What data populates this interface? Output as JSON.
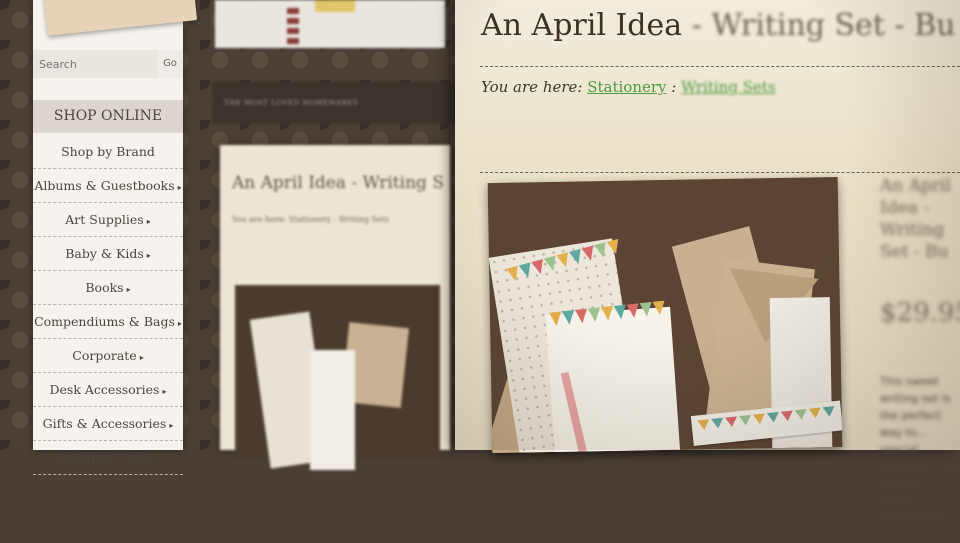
{
  "sidebar": {
    "search_placeholder": "Search",
    "go_label": "Go",
    "shop_title": "SHOP ONLINE",
    "items": [
      {
        "label": "Shop by Brand",
        "submenu": false
      },
      {
        "label": "Albums & Guestbooks",
        "submenu": true
      },
      {
        "label": "Art Supplies",
        "submenu": true
      },
      {
        "label": "Baby & Kids",
        "submenu": true
      },
      {
        "label": "Books",
        "submenu": true
      },
      {
        "label": "Compendiums & Bags",
        "submenu": true
      },
      {
        "label": "Corporate",
        "submenu": true
      },
      {
        "label": "Desk Accessories",
        "submenu": true
      },
      {
        "label": "Gifts & Accessories",
        "submenu": true
      },
      {
        "label": "Greeting Cards",
        "submenu": true
      }
    ],
    "caret_icon": "triangle-right-icon"
  },
  "main": {
    "title_prefix": "An April Idea",
    "title_blurred": " - Writing Set - Bu",
    "breadcrumb_prefix": "You are here: ",
    "breadcrumb_links": [
      "Stationery",
      "Writing Sets"
    ],
    "breadcrumb_sep": " : ",
    "product_title_blur": "An April Idea - Writing Set - Bu",
    "price_blur": "$29.95",
    "description_blur": "This sweet writing set is the perfect way to... special someone... an original hand... pattern and l..."
  },
  "mid_layer": {
    "nav_text": "THE MOST LOVED   HOMEWARES",
    "title": "An April Idea - Writing S",
    "breadcrumb": "You are here: Stationery : Writing Sets"
  },
  "colors": {
    "accent_link": "#4d9a3f",
    "heading": "#3f3026",
    "sidebar_bg": "#f6f3ee"
  }
}
